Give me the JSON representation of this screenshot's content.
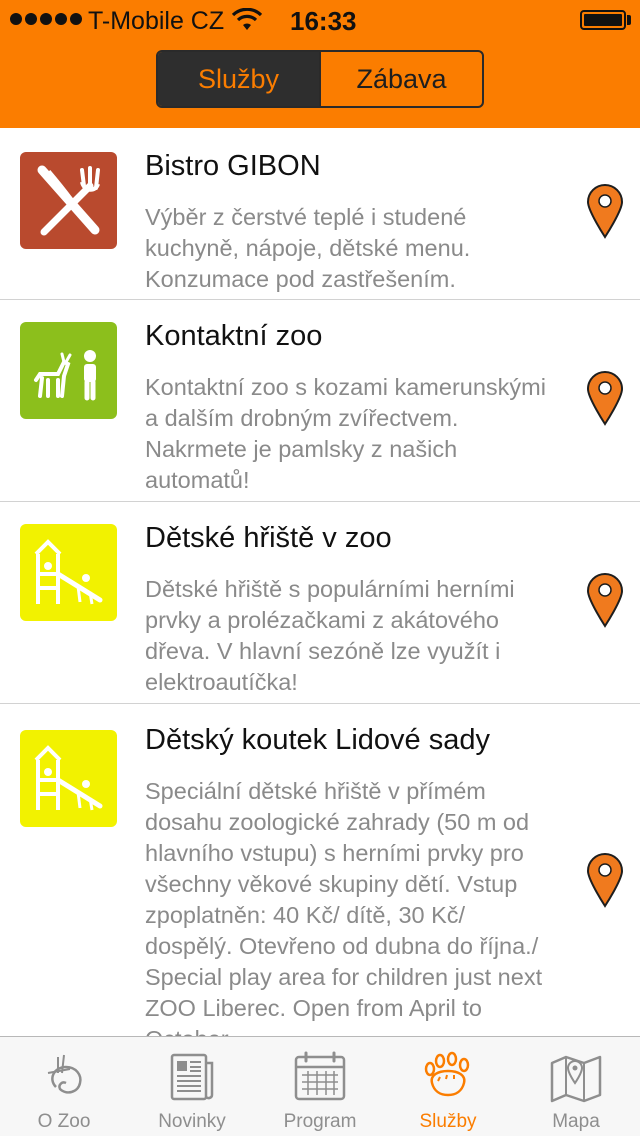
{
  "status_bar": {
    "carrier": "T-Mobile CZ",
    "time": "16:33",
    "signal_icon": "signal-dots-icon",
    "wifi_icon": "wifi-icon",
    "battery_icon": "battery-icon"
  },
  "segment": {
    "items": [
      {
        "label": "Služby",
        "selected": true
      },
      {
        "label": "Zábava",
        "selected": false
      }
    ]
  },
  "colors": {
    "accent": "#fb7d00",
    "restaurant_icon_bg": "#b94a2e",
    "contact_zoo_icon_bg": "#8cbf1c",
    "playground_icon_bg": "#f2f200",
    "map_pin": "#f07a1e"
  },
  "list": {
    "items": [
      {
        "title": "Bistro GIBON",
        "description": "Výběr z čerstvé teplé i studené\nkuchyně, nápoje, dětské menu.\nKonzumace pod zastřešením.",
        "icon": "fork-knife-icon"
      },
      {
        "title": "Kontaktní zoo",
        "description": "Kontaktní zoo s kozami kamerunskými\na dalším drobným zvířectvem.\nNakrmete je pamlsky z našich\nautomatů!",
        "icon": "goat-person-icon"
      },
      {
        "title": "Dětské hřiště v zoo",
        "description": "Dětské hřiště s populárními herními\nprvky a prolézačkami z akátového\ndřeva. V hlavní sezóně lze využít i\nelektroautíčka!",
        "icon": "playground-icon"
      },
      {
        "title": "Dětský koutek Lidové sady",
        "description": "Speciální dětské hřiště v přímém\ndosahu zoologické zahrady (50 m od\nhlavního vstupu) s herními prvky pro\nvšechny věkové skupiny dětí. Vstup\nzpoplatněn: 40 Kč/ dítě, 30 Kč/\ndospělý. Otevřeno od dubna do října./\nSpecial play area for children just next\nZOO Liberec. Open from April to\nOctober.",
        "icon": "playground-icon"
      }
    ]
  },
  "tabbar": {
    "items": [
      {
        "label": "O Zoo",
        "icon": "zoo-logo-icon",
        "active": false
      },
      {
        "label": "Novinky",
        "icon": "newspaper-icon",
        "active": false
      },
      {
        "label": "Program",
        "icon": "calendar-icon",
        "active": false
      },
      {
        "label": "Služby",
        "icon": "paw-icon",
        "active": true
      },
      {
        "label": "Mapa",
        "icon": "map-icon",
        "active": false
      }
    ]
  }
}
